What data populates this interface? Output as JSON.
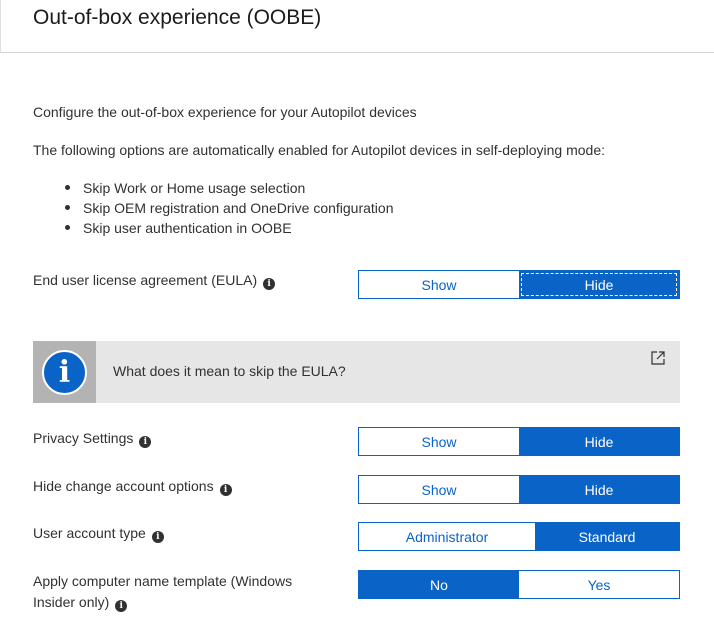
{
  "header": {
    "title": "Out-of-box experience (OOBE)"
  },
  "intro": {
    "line1": "Configure the out-of-box experience for your Autopilot devices",
    "line2": "The following options are automatically enabled for Autopilot devices in self-deploying mode:",
    "bullets": [
      "Skip Work or Home usage selection",
      "Skip OEM registration and OneDrive configuration",
      "Skip user authentication in OOBE"
    ]
  },
  "eula": {
    "label": "End user license agreement (EULA)",
    "options": [
      "Show",
      "Hide"
    ],
    "selected": "Hide"
  },
  "infobox": {
    "text": "What does it mean to skip the EULA?",
    "icon": "info-icon",
    "link_icon": "external-link-icon"
  },
  "privacy": {
    "label": "Privacy Settings",
    "options": [
      "Show",
      "Hide"
    ],
    "selected": "Hide"
  },
  "hide_change_account": {
    "label": "Hide change account options",
    "options": [
      "Show",
      "Hide"
    ],
    "selected": "Hide"
  },
  "user_account_type": {
    "label": "User account type",
    "options": [
      "Administrator",
      "Standard"
    ],
    "selected": "Standard"
  },
  "computer_name": {
    "label_line1": "Apply computer name template (Windows",
    "label_line2": "Insider only)",
    "options": [
      "No",
      "Yes"
    ],
    "selected": "No"
  },
  "colors": {
    "accent": "#0a63c7",
    "infobox_bg": "#e6e6e6",
    "text": "#323130"
  }
}
